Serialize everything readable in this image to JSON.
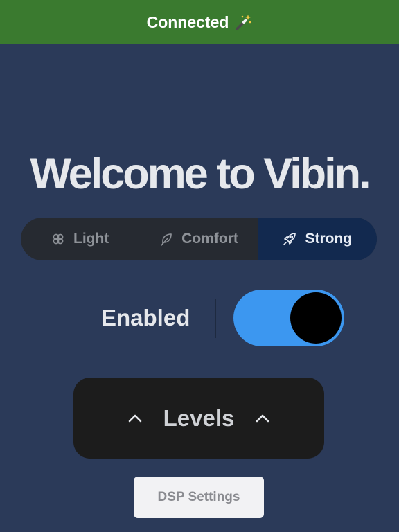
{
  "status": {
    "text": "Connected",
    "icon": "magic-wand-icon",
    "background": "#3a7a2f"
  },
  "title": "Welcome to Vibin.",
  "modes": {
    "items": [
      {
        "label": "Light",
        "icon": "flower-icon"
      },
      {
        "label": "Comfort",
        "icon": "feather-icon"
      },
      {
        "label": "Strong",
        "icon": "rocket-icon"
      }
    ],
    "selected": "Strong"
  },
  "enabled": {
    "label": "Enabled",
    "on": true,
    "track_color": "#3c97f0"
  },
  "levels": {
    "label": "Levels",
    "icon": "chevron-up-icon"
  },
  "dsp": {
    "label": "DSP Settings"
  }
}
